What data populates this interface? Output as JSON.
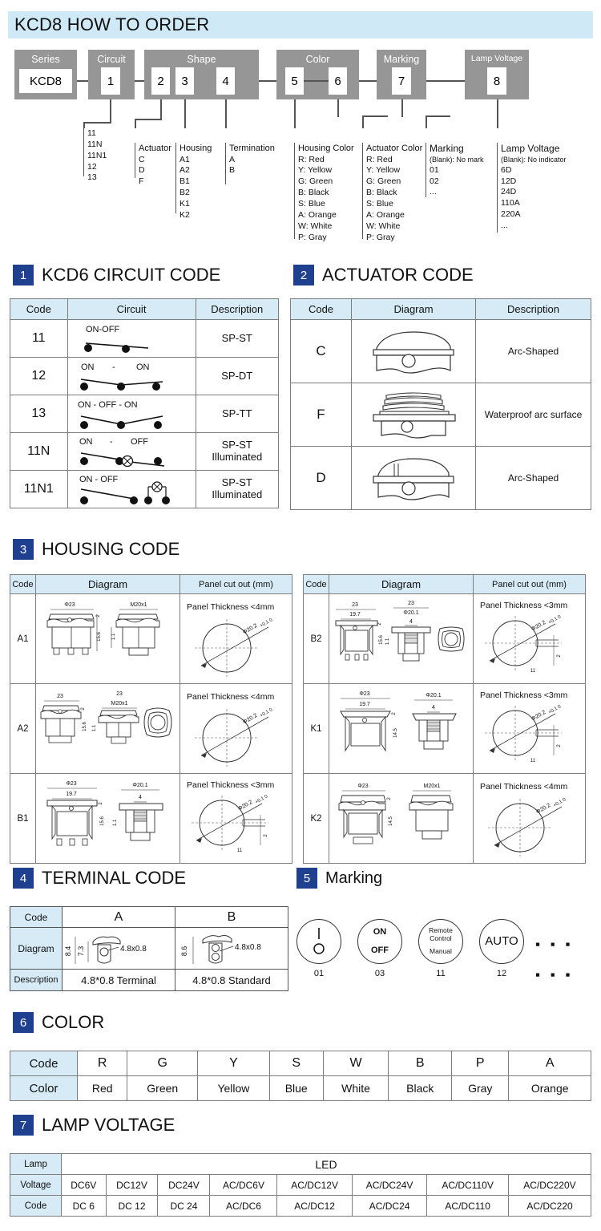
{
  "header": {
    "title": "KCD8 HOW TO ORDER"
  },
  "flow": {
    "boxes": [
      {
        "title": "Series",
        "codes": [
          "KCD8"
        ]
      },
      {
        "title": "Circuit",
        "codes": [
          "1"
        ]
      },
      {
        "title": "Shape",
        "codes": [
          "2",
          "3",
          "4"
        ]
      },
      {
        "title": "Color",
        "codes": [
          "5",
          "6"
        ]
      },
      {
        "title": "Marking",
        "codes": [
          "7"
        ]
      },
      {
        "title": "Lamp  Voltage",
        "codes": [
          "8"
        ]
      }
    ]
  },
  "legend": {
    "circuit": {
      "head": "",
      "items": [
        "11",
        "11N",
        "11N1",
        "12",
        "13"
      ]
    },
    "actuator": {
      "head": "Actuator",
      "items": [
        "C",
        "D",
        "F"
      ]
    },
    "housing": {
      "head": "Housing",
      "items": [
        "A1",
        "A2",
        "B1",
        "B2",
        "K1",
        "K2"
      ]
    },
    "termination": {
      "head": "Termination",
      "items": [
        "A",
        "B"
      ]
    },
    "housing_color": {
      "head": "Housing Color",
      "items": [
        "R:  Red",
        "Y:  Yellow",
        "G:  Green",
        "B:  Black",
        "S:  Blue",
        "A:  Orange",
        "W: White",
        "P:  Gray"
      ]
    },
    "actuator_color": {
      "head": "Actuator Color",
      "items": [
        "R:  Red",
        "Y:  Yellow",
        "G:  Green",
        "B:  Black",
        "S:  Blue",
        "A:  Orange",
        "W: White",
        "P:  Gray"
      ]
    },
    "marking": {
      "head": "Marking",
      "blank": "(Blank):  No mark",
      "items": [
        "01",
        "02",
        "..."
      ]
    },
    "lamp_voltage": {
      "head": "Lamp Voltage",
      "blank": "(Blank):  No indicator",
      "items": [
        "6D",
        "12D",
        "24D",
        "110A",
        "220A",
        "..."
      ]
    }
  },
  "sections": {
    "s1": {
      "num": "1",
      "title": "KCD6 CIRCUIT CODE"
    },
    "s2": {
      "num": "2",
      "title": "ACTUATOR CODE"
    },
    "s3": {
      "num": "3",
      "title": "HOUSING CODE"
    },
    "s4": {
      "num": "4",
      "title": "TERMINAL CODE"
    },
    "s5": {
      "num": "5",
      "title": "Marking"
    },
    "s6": {
      "num": "6",
      "title": "COLOR"
    },
    "s7": {
      "num": "7",
      "title": "LAMP VOLTAGE"
    }
  },
  "circuit_table": {
    "headers": [
      "Code",
      "Circuit",
      "Description"
    ],
    "rows": [
      {
        "code": "11",
        "labels": "ON-OFF",
        "desc": "SP-ST"
      },
      {
        "code": "12",
        "labels": "ON   -   ON",
        "desc": "SP-DT"
      },
      {
        "code": "13",
        "labels": "ON - OFF - ON",
        "desc": "SP-TT"
      },
      {
        "code": "11N",
        "labels": "ON   -   OFF",
        "desc": "SP-ST Illuminated"
      },
      {
        "code": "11N1",
        "labels": "ON -  OFF",
        "desc": "SP-ST Illuminated"
      }
    ]
  },
  "actuator_table": {
    "headers": [
      "Code",
      "Diagram",
      "Description"
    ],
    "rows": [
      {
        "code": "C",
        "desc": "Arc-Shaped"
      },
      {
        "code": "F",
        "desc": "Waterproof arc surface"
      },
      {
        "code": "D",
        "desc": "Arc-Shaped"
      }
    ]
  },
  "housing_table": {
    "headers": [
      "Code",
      "Diagram",
      "Panel cut out (mm)"
    ],
    "left_rows": [
      {
        "code": "A1",
        "panel": "Panel Thickness <4mm",
        "dims": [
          "Φ23",
          "M20x1",
          "2",
          "15.6",
          "1.1"
        ],
        "cut": "Φ20.2",
        "tol": "+0.1 0"
      },
      {
        "code": "A2",
        "panel": "Panel Thickness <4mm",
        "dims": [
          "23",
          "23",
          "M20x1",
          "2",
          "15.6",
          "1.1"
        ],
        "cut": "Φ20.2",
        "tol": "+0.1 0"
      },
      {
        "code": "B1",
        "panel": "Panel Thickness <3mm",
        "dims": [
          "Φ23",
          "19.7",
          "Φ20.1",
          "4",
          "2",
          "15.6",
          "1.1"
        ],
        "cut": "Φ20.2",
        "tol": "+0.1 0",
        "extra": [
          "11",
          "2"
        ]
      }
    ],
    "right_rows": [
      {
        "code": "B2",
        "panel": "Panel Thickness <3mm",
        "dims": [
          "23",
          "19.7",
          "23",
          "Φ20.1",
          "4",
          "2",
          "15.6",
          "1.1"
        ],
        "cut": "Φ20.2",
        "tol": "+0.1 0",
        "extra": [
          "11",
          "2"
        ]
      },
      {
        "code": "K1",
        "panel": "Panel Thickness <3mm",
        "dims": [
          "Φ23",
          "19.7",
          "Φ20.1",
          "4",
          "2",
          "14.5"
        ],
        "cut": "Φ20.2",
        "tol": "+0.1 0",
        "extra": [
          "11",
          "2"
        ]
      },
      {
        "code": "K2",
        "panel": "Panel Thickness <4mm",
        "dims": [
          "Φ23",
          "M20x1",
          "2",
          "14.5"
        ],
        "cut": "Φ20.2",
        "tol": "+0.1 0"
      }
    ]
  },
  "terminal_table": {
    "row_labels": [
      "Code",
      "Diagram",
      "Description"
    ],
    "columns": [
      {
        "code": "A",
        "dims": [
          "8.4",
          "7.3",
          "4.8x0.8"
        ],
        "desc": "4.8*0.8 Terminal"
      },
      {
        "code": "B",
        "dims": [
          "8.6",
          "4.8x0.8"
        ],
        "desc": "4.8*0.8 Standard"
      }
    ]
  },
  "marking": {
    "items": [
      {
        "code": "01",
        "type": "line-circle",
        "lines": []
      },
      {
        "code": "03",
        "type": "text",
        "lines": [
          "ON",
          "OFF"
        ]
      },
      {
        "code": "11",
        "type": "text-small",
        "lines": [
          "Remote",
          "Control",
          "Manual"
        ]
      },
      {
        "code": "12",
        "type": "text-big",
        "lines": [
          "AUTO"
        ]
      }
    ],
    "ellipsis": "▪ ▪ ▪"
  },
  "color_table": {
    "row_labels": [
      "Code",
      "Color"
    ],
    "codes": [
      "R",
      "G",
      "Y",
      "S",
      "W",
      "B",
      "P",
      "A"
    ],
    "colors": [
      "Red",
      "Green",
      "Yellow",
      "Blue",
      "White",
      "Black",
      "Gray",
      "Orange"
    ]
  },
  "lamp_table": {
    "row_labels": [
      "Lamp",
      "Voltage",
      "Code"
    ],
    "lamp_type": "LED",
    "voltages": [
      "DC6V",
      "DC12V",
      "DC24V",
      "AC/DC6V",
      "AC/DC12V",
      "AC/DC24V",
      "AC/DC110V",
      "AC/DC220V"
    ],
    "codes": [
      "DC 6",
      "DC 12",
      "DC 24",
      "AC/DC6",
      "AC/DC12",
      "AC/DC24",
      "AC/DC110",
      "AC/DC220"
    ]
  },
  "theme": {
    "header_band": "#cfe9f6",
    "flow_box": "#969696",
    "badge": "#1f3f8f",
    "table_header": "#d6ebf5"
  }
}
